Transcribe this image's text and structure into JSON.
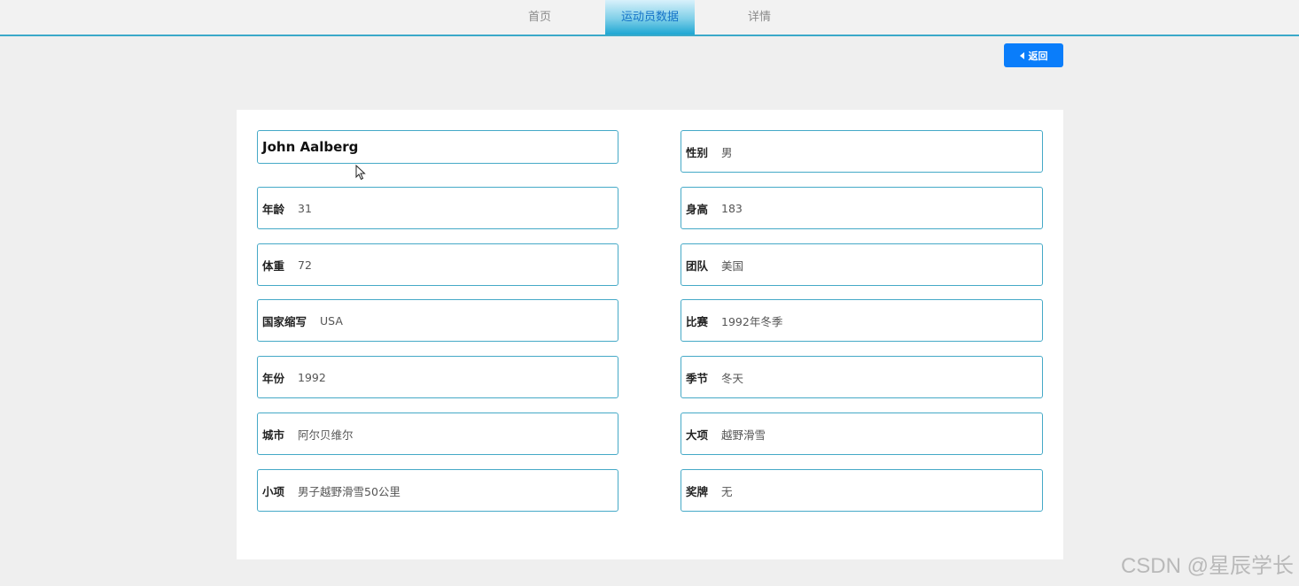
{
  "nav": {
    "tabs": [
      {
        "label": "首页"
      },
      {
        "label": "运动员数据"
      },
      {
        "label": "详情"
      }
    ]
  },
  "back_button": {
    "label": "返回"
  },
  "athlete": {
    "name": "John Aalberg",
    "fields": {
      "gender": {
        "label": "性别",
        "value": "男"
      },
      "age": {
        "label": "年龄",
        "value": "31"
      },
      "height": {
        "label": "身高",
        "value": "183"
      },
      "weight": {
        "label": "体重",
        "value": "72"
      },
      "team": {
        "label": "团队",
        "value": "美国"
      },
      "noc": {
        "label": "国家缩写",
        "value": "USA"
      },
      "games": {
        "label": "比赛",
        "value": "1992年冬季"
      },
      "year": {
        "label": "年份",
        "value": "1992"
      },
      "season": {
        "label": "季节",
        "value": "冬天"
      },
      "city": {
        "label": "城市",
        "value": "阿尔贝维尔"
      },
      "sport": {
        "label": "大项",
        "value": "越野滑雪"
      },
      "event": {
        "label": "小项",
        "value": "男子越野滑雪50公里"
      },
      "medal": {
        "label": "奖牌",
        "value": "无"
      }
    }
  },
  "watermark": "CSDN @星辰学长",
  "colors": {
    "accent_blue": "#0a7dfa",
    "field_border": "#45a9c7",
    "active_tab_text": "#1473c8"
  }
}
